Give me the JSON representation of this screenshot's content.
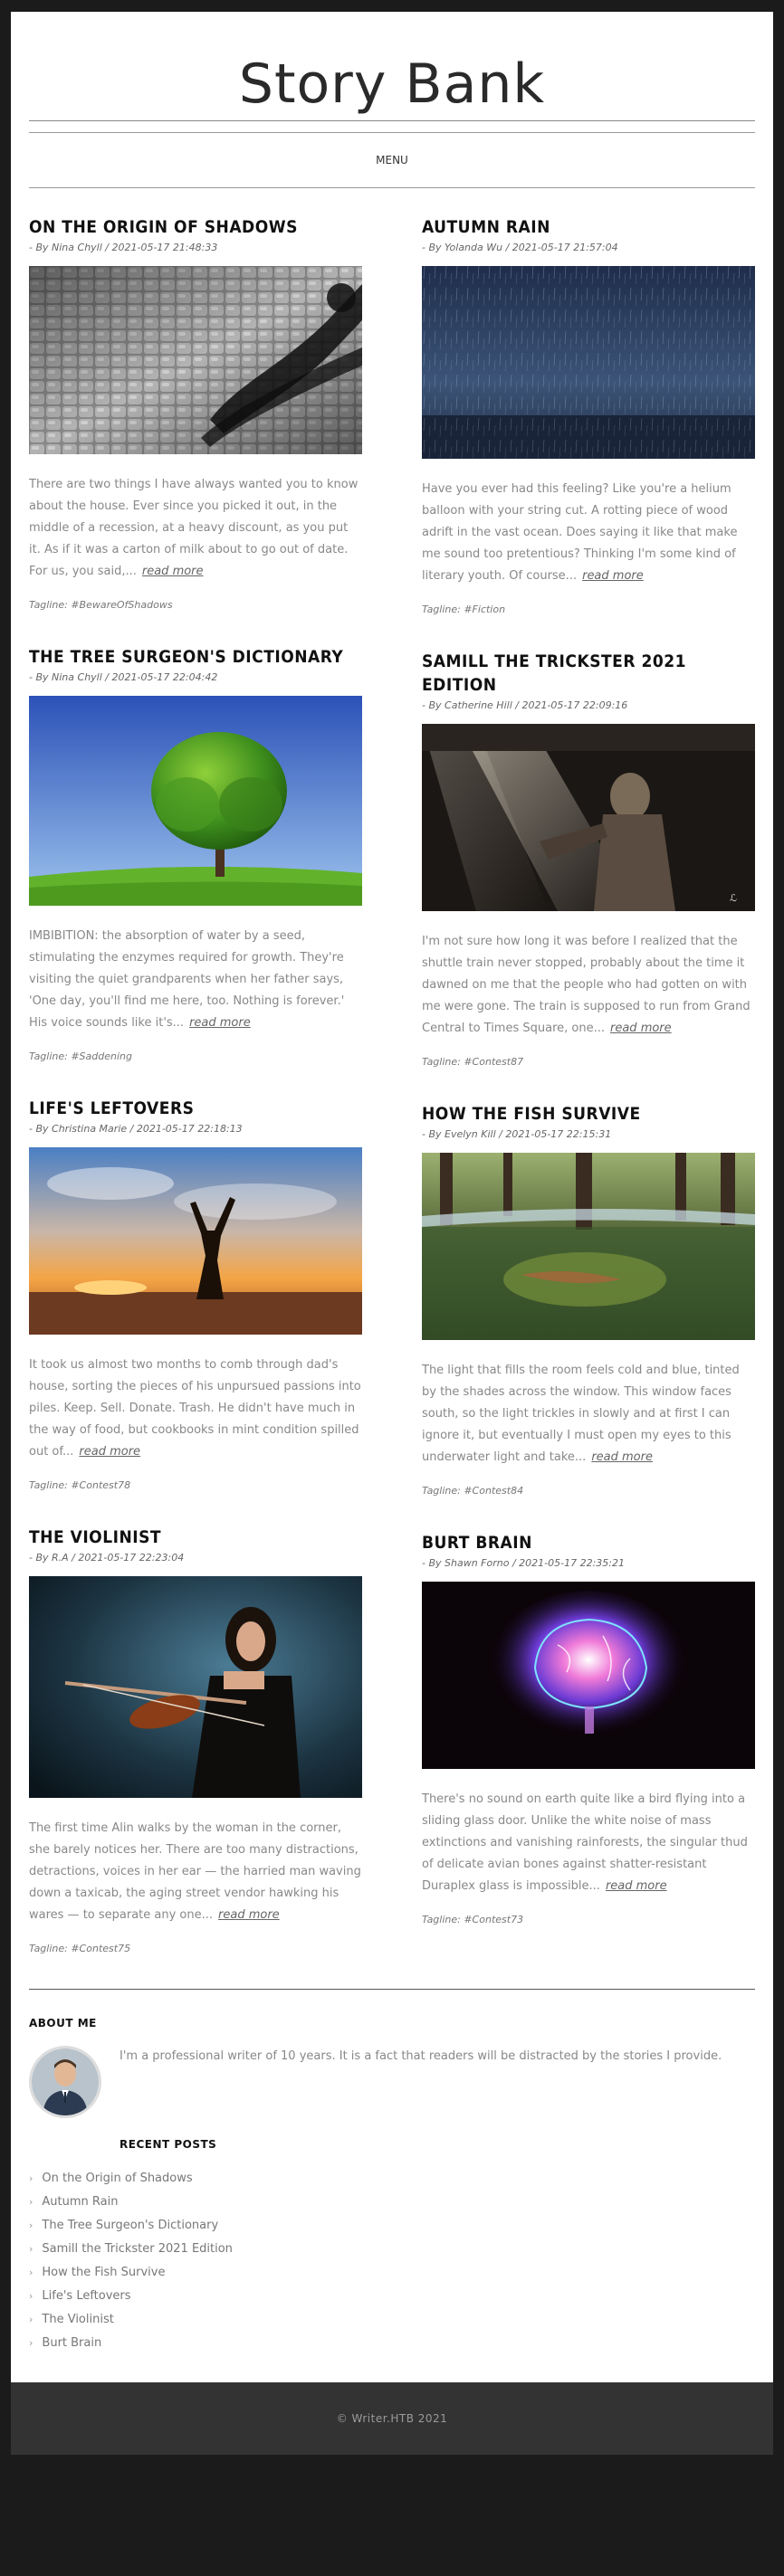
{
  "site": {
    "title": "Story Bank",
    "menu_label": "MENU"
  },
  "posts_left": [
    {
      "title": "On the Origin of Shadows",
      "meta": "- By Nina Chyll / 2021-05-17 21:48:33",
      "image": "shadow-cobblestone",
      "excerpt": "There are two things I have always wanted you to know about the house. Ever since you picked it out, in the middle of a recession, at a heavy discount, as you put it. As if it was a carton of milk about to go out of date. For us, you said,...",
      "read_more": "read more",
      "tagline": "Tagline: #BewareOfShadows"
    },
    {
      "title": "The Tree Surgeon's Dictionary",
      "meta": "- By Nina Chyll / 2021-05-17 22:04:42",
      "image": "green-tree",
      "excerpt": "IMBIBITION: the absorption of water by a seed, stimulating the enzymes required for growth. They're visiting the quiet grandparents when her father says, 'One day, you'll find me here, too. Nothing is forever.' His voice sounds like it's...",
      "read_more": "read more",
      "tagline": "Tagline: #Saddening"
    },
    {
      "title": "Life's Leftovers",
      "meta": "- By Christina Marie / 2021-05-17 22:18:13",
      "image": "sunset-handstand",
      "excerpt": "It took us almost two months to comb through dad's house, sorting the pieces of his unpursued passions into piles. Keep. Sell. Donate. Trash. He didn't have much in the way of food, but cookbooks in mint condition spilled out of...",
      "read_more": "read more",
      "tagline": "Tagline: #Contest78"
    },
    {
      "title": "The Violinist",
      "meta": "- By R.A / 2021-05-17 22:23:04",
      "image": "violinist",
      "excerpt": "The first time Alin walks by the woman in the corner, she barely notices her. There are too many distractions, detractions, voices in her ear — the harried man waving down a taxicab, the aging street vendor hawking his wares — to separate any one...",
      "read_more": "read more",
      "tagline": "Tagline: #Contest75"
    }
  ],
  "posts_right": [
    {
      "title": "Autumn Rain",
      "meta": "- By Yolanda Wu / 2021-05-17 21:57:04",
      "image": "rain",
      "excerpt": "Have you ever had this feeling? Like you're a helium balloon with your string cut. A rotting piece of wood adrift in the vast ocean. Does saying it like that make me sound too pretentious? Thinking I'm some kind of literary youth. Of course...",
      "read_more": "read more",
      "tagline": "Tagline: #Fiction"
    },
    {
      "title": "Samill the Trickster 2021 Edition",
      "meta": "- By Catherine Hill / 2021-05-17 22:09:16",
      "image": "dark-train",
      "excerpt": "I'm not sure how long it was before I realized that the shuttle train never stopped, probably about the time it dawned on me that the people who had gotten on with me were gone. The train is supposed to run from Grand Central to Times Square, one...",
      "read_more": "read more",
      "tagline": "Tagline: #Contest87"
    },
    {
      "title": "How the Fish Survive",
      "meta": "- By Evelyn Kill / 2021-05-17 22:15:31",
      "image": "underwater-forest",
      "excerpt": "The light that fills the room feels cold and blue, tinted by the shades across the window. This window faces south, so the light trickles in slowly and at first I can ignore it, but eventually I must open my eyes to this underwater light and take...",
      "read_more": "read more",
      "tagline": "Tagline: #Contest84"
    },
    {
      "title": "Burt Brain",
      "meta": "- By Shawn Forno / 2021-05-17 22:35:21",
      "image": "glowing-brain",
      "excerpt": "There's no sound on earth quite like a bird flying into a sliding glass door. Unlike the white noise of mass extinctions and vanishing rainforests, the singular thud of delicate avian bones against shatter-resistant Duraplex glass is impossible...",
      "read_more": "read more",
      "tagline": "Tagline: #Contest73"
    }
  ],
  "about": {
    "heading": "ABOUT ME",
    "text": "I'm a professional writer of 10 years. It is a fact that readers will be distracted by the stories I provide."
  },
  "recent": {
    "heading": "RECENT POSTS",
    "items": [
      "On the Origin of Shadows",
      "Autumn Rain",
      "The Tree Surgeon's Dictionary",
      "Samill the Trickster 2021 Edition",
      "How the Fish Survive",
      "Life's Leftovers",
      "The Violinist",
      "Burt Brain"
    ]
  },
  "footer": {
    "text": "© Writer.HTB 2021"
  }
}
